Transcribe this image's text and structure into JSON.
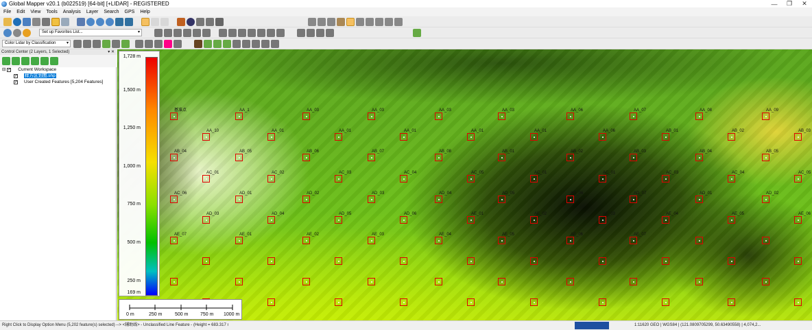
{
  "window": {
    "title": "Global Mapper v20.1 (b022519) [64-bit] [+LIDAR] - REGISTERED"
  },
  "menu": [
    "File",
    "Edit",
    "View",
    "Tools",
    "Analysis",
    "Layer",
    "Search",
    "GPS",
    "Help"
  ],
  "toolbars": {
    "favorites_placeholder": "Set up Favorites List...",
    "shader_selected": "Color Lidar by Classification"
  },
  "control_center": {
    "title": "Control Center (2 Layers, 1 Selected)",
    "workspace_label": "Current Workspace",
    "layers": [
      {
        "label": "样方区划图.shp",
        "selected": true
      },
      {
        "label": "User Created Features [5,204 Features]",
        "selected": false
      }
    ]
  },
  "legend": {
    "labels": [
      "1,728 m",
      "1,500 m",
      "1,250 m",
      "1,000 m",
      "750 m",
      "500 m",
      "250 m",
      "169 m"
    ],
    "elevations": [
      1728,
      1500,
      1250,
      1000,
      750,
      500,
      250,
      169
    ]
  },
  "scale_bar": {
    "labels": [
      "0 m",
      "250 m",
      "500 m",
      "750 m",
      "1000 m"
    ]
  },
  "map_labels": [
    "基准点",
    "AA_1",
    "AA_03",
    "AA_03",
    "AA_03",
    "AA_03",
    "AA_06",
    "AA_07",
    "AA_08",
    "AA_09",
    "AA_10",
    "AA_01",
    "AA_01",
    "AA_01",
    "AA_01",
    "AA_01",
    "AA_06",
    "AB_01",
    "AB_02",
    "AB_03",
    "AB_04",
    "AB_05",
    "AB_06",
    "AB_07",
    "AB_08",
    "AB_01",
    "AB_02",
    "AB_03",
    "AB_04",
    "AB_05",
    "AC_01",
    "AC_02",
    "AC_03",
    "AC_04",
    "AC_05",
    "AC_01",
    "AC_01",
    "AC_03",
    "AC_04",
    "AC_05",
    "AC_06",
    "AD_01",
    "AD_02",
    "AD_03",
    "AD_04",
    "AD_05",
    "AD_06",
    "AD_07",
    "AD_01",
    "AD_02",
    "AD_03",
    "AD_04",
    "AD_05",
    "AD_06",
    "AE_01",
    "AE_02",
    "AE_03",
    "AE_04",
    "AE_05",
    "AE_06",
    "AE_07",
    "AE_01",
    "AE_02",
    "AE_03",
    "AE_04",
    "AE_05",
    "AE_06",
    "AE_07"
  ],
  "status": {
    "hint": "Right Click to Display Option Menu (5,202 feature(s) selected) --> <辅助线> - Unclassified Line Feature - (Height = 683.317 m - 样方区划图.shp)",
    "scale": "1:11620",
    "coords": "GEO | WGS84 | (121.0809705299, 50.63490558) | 4,074,2..."
  }
}
